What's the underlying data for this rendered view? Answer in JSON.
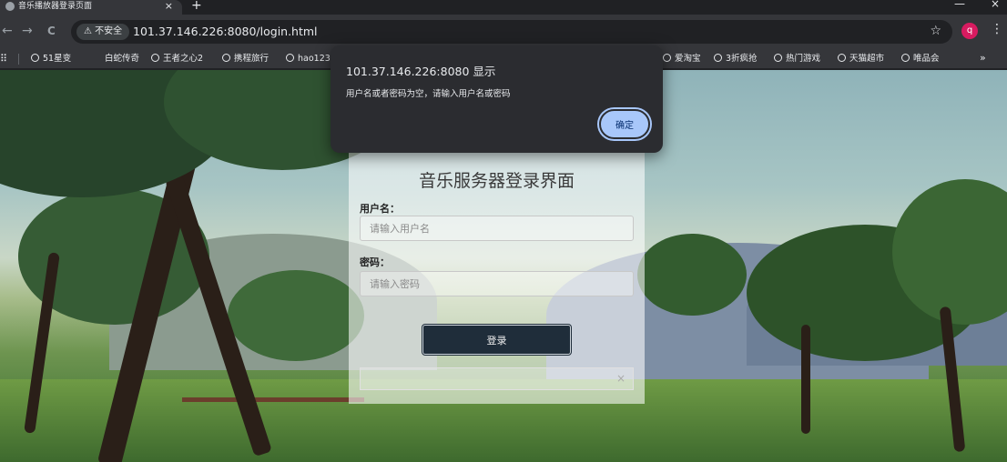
{
  "browser": {
    "tab_title": "音乐播放器登录页面",
    "tab_close": "×",
    "new_tab": "+",
    "window_min": "—",
    "window_close": "×",
    "nav": {
      "back": "←",
      "forward": "→",
      "reload": "C"
    },
    "security_label": "⚠ 不安全",
    "url": "101.37.146.226:8080/login.html",
    "star": "☆",
    "avatar_letter": "q",
    "menu": "⋮"
  },
  "bookmarks": {
    "apps": "⠿",
    "items": [
      "51星变",
      "白蛇传奇",
      "王者之心2",
      "携程旅行",
      "hao123",
      "爱淘宝",
      "3折疯抢",
      "热门游戏",
      "天猫超市",
      "唯品会"
    ],
    "more": "»"
  },
  "login": {
    "title": "音乐服务器登录界面",
    "username_label": "用户名：",
    "username_placeholder": "请输入用户名",
    "password_label": "密码：",
    "password_placeholder": "请输入密码",
    "submit": "登录",
    "alert_close": "×"
  },
  "dialog": {
    "title": "101.37.146.226:8080 显示",
    "message": "用户名或者密码为空，请输入用户名或密码",
    "ok": "确定"
  }
}
